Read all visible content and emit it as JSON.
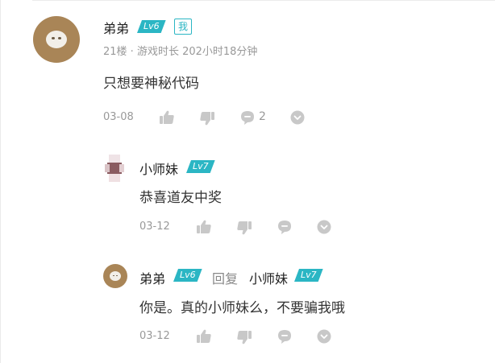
{
  "main_comment": {
    "author": "弟弟",
    "level": "Lv6",
    "me_tag": "我",
    "floor_info": "21楼 · 游戏时长 202小时18分钟",
    "content": "只想要神秘代码",
    "date": "03-08",
    "comment_count": "2"
  },
  "replies": [
    {
      "author": "小师妹",
      "level": "Lv7",
      "content": "恭喜道友中奖",
      "date": "03-12"
    },
    {
      "author": "弟弟",
      "level": "Lv6",
      "reply_word": "回复",
      "reply_to": "小师妹",
      "reply_to_level": "Lv7",
      "content": "你是。真的小师妹么，不要骗我哦",
      "date": "03-12"
    }
  ],
  "icons": [
    "thumbs-up-icon",
    "thumbs-down-icon",
    "comment-bubble-icon",
    "chevron-down-circle-icon"
  ],
  "colors": {
    "level_badge": "#2bb6c4",
    "icon_gray": "#c8c8c8"
  }
}
